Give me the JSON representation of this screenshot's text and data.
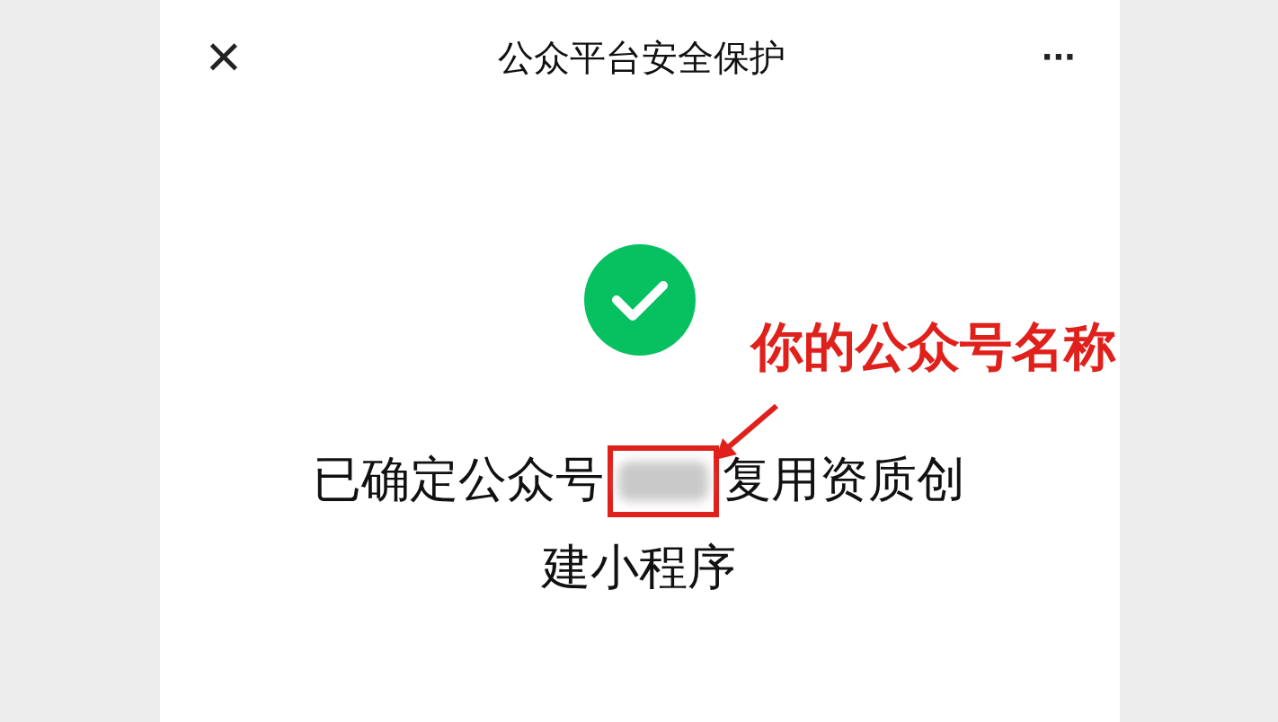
{
  "header": {
    "close": "×",
    "title": "公众平台安全保护",
    "more": "···"
  },
  "status": {
    "kind": "success"
  },
  "message": {
    "before": "已确定公众号",
    "after": "复用资质创",
    "line2": "建小程序",
    "redacted": true
  },
  "annotation": {
    "label": "你的公众号名称"
  }
}
